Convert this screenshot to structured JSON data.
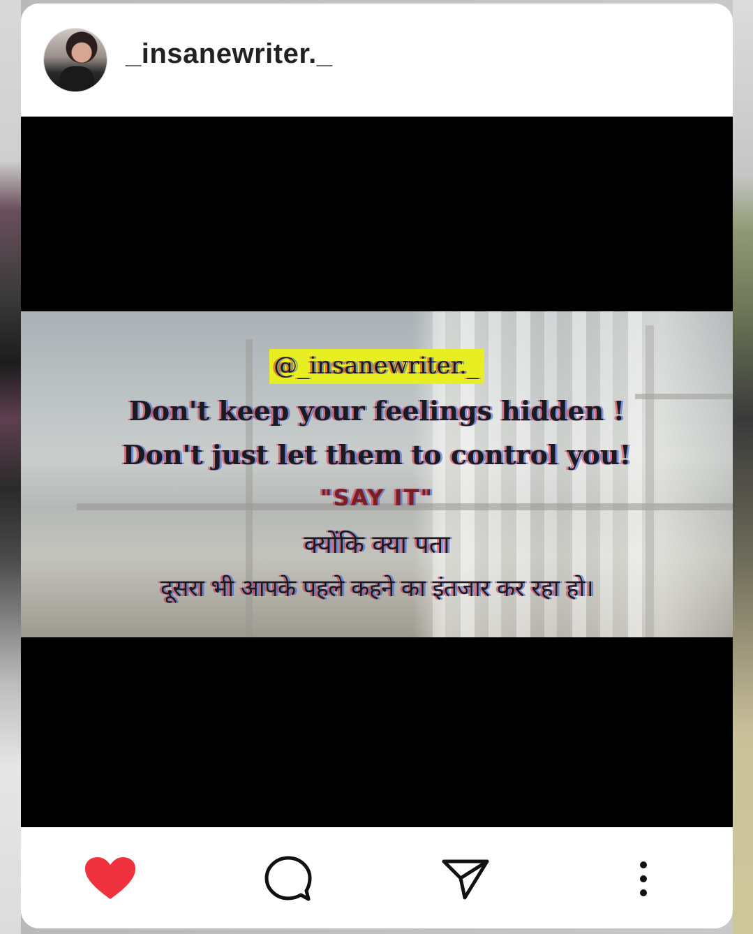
{
  "post": {
    "username": "_insanewriter._",
    "overlay": {
      "handle": "@_insanewriter._",
      "line1": "Don't keep your feelings hidden !",
      "line2": "Don't just let them to control you!",
      "line3": "\"SAY IT\"",
      "line4": "क्योंकि क्या पता",
      "line5": "दूसरा भी आपके पहले कहने का इंतजार कर रहा हो।"
    },
    "highlight_color": "#e7ef22",
    "like_color": "#f0313e"
  },
  "actions": {
    "like_icon": "heart-icon",
    "comment_icon": "speech-bubble-icon",
    "share_icon": "paper-plane-icon",
    "more_icon": "vertical-dots-icon"
  }
}
